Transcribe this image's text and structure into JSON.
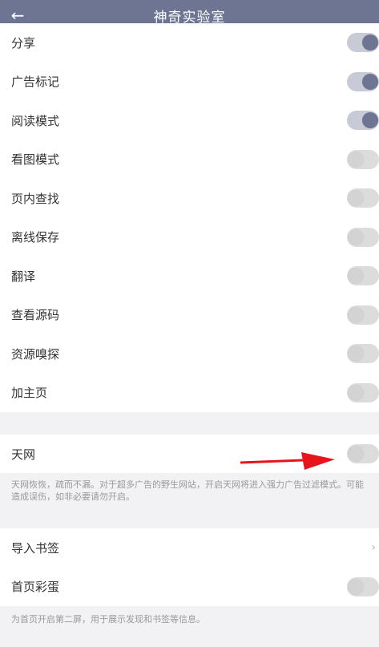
{
  "header": {
    "title": "神奇实验室",
    "back_icon": "arrow-left-icon"
  },
  "lab_items": [
    {
      "label": "分享",
      "enabled": true
    },
    {
      "label": "广告标记",
      "enabled": true
    },
    {
      "label": "阅读模式",
      "enabled": true
    },
    {
      "label": "看图模式",
      "enabled": false
    },
    {
      "label": "页内查找",
      "enabled": false
    },
    {
      "label": "离线保存",
      "enabled": false
    },
    {
      "label": "翻译",
      "enabled": false
    },
    {
      "label": "查看源码",
      "enabled": false
    },
    {
      "label": "资源嗅探",
      "enabled": false
    },
    {
      "label": "加主页",
      "enabled": false
    }
  ],
  "tianwang": {
    "label": "天网",
    "enabled": false,
    "description": "天网恢恢，疏而不漏。对于超多广告的野生网站，开启天网将进入强力广告过滤模式。可能造成误伤，如非必要请勿开启。"
  },
  "import_bookmarks": {
    "label": "导入书签"
  },
  "homepage_easter_egg": {
    "label": "首页彩蛋",
    "enabled": false,
    "description": "为首页开启第二屏，用于展示发现和书签等信息。"
  },
  "colors": {
    "header_bg": "#6d7592",
    "toggle_on": "#6d7592",
    "toggle_off": "#d3d3d3",
    "annotation_arrow": "#e8141b"
  }
}
